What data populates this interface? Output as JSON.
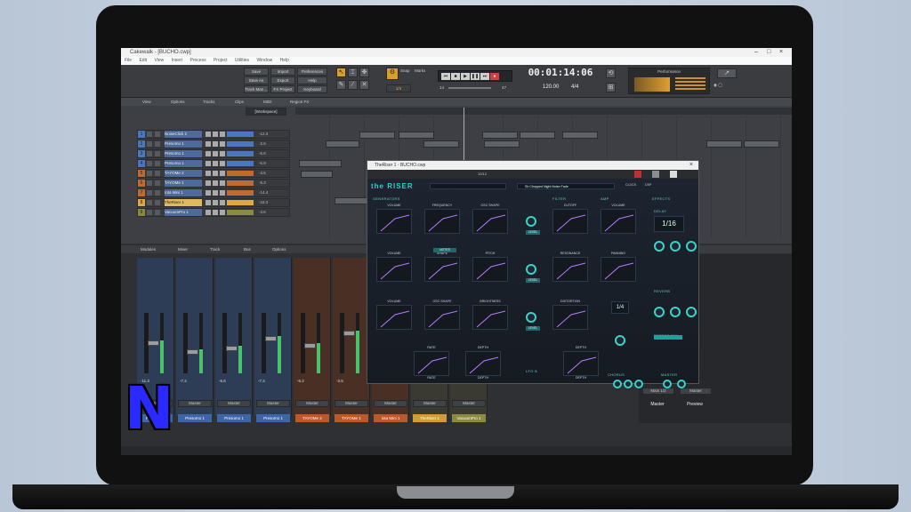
{
  "window": {
    "title": "Cakewalk - [BUCHO.cwp]",
    "controls": [
      "–",
      "□",
      "×"
    ]
  },
  "menu": [
    "File",
    "Edit",
    "View",
    "Insert",
    "Process",
    "Project",
    "Utilities",
    "Window",
    "Help"
  ],
  "controlbar": {
    "buttons": [
      "Save",
      "Import",
      "Preferences",
      "Save As",
      "Export",
      "Help",
      "Track Man…",
      "FX Project",
      "Keyboard"
    ],
    "snap": "Snap",
    "marks": "Marks",
    "snap_value": "1/4",
    "time": "00:01:14:06",
    "tempo": "120.00",
    "meter": "4/4",
    "performance_label": "Performance",
    "transport_left": "14",
    "transport_right": "47"
  },
  "lane_header": [
    "View",
    "Options",
    "Tracks",
    "Clips",
    "MIDI",
    "Region FX"
  ],
  "workspace": "[Workspace]",
  "tracks": [
    {
      "num": "1",
      "name": "NoiseClick 2",
      "vol": "-12.3",
      "color": "#4a78c0"
    },
    {
      "num": "2",
      "name": "Presomo 1",
      "vol": "-2.6",
      "color": "#4a78c0"
    },
    {
      "num": "3",
      "name": "Presomo 1",
      "vol": "-6.6",
      "color": "#4a78c0"
    },
    {
      "num": "4",
      "name": "Presomo 1",
      "vol": "-6.9",
      "color": "#4a78c0"
    },
    {
      "num": "5",
      "name": "TAYOMe 2",
      "vol": "-3.5",
      "color": "#c06a30"
    },
    {
      "num": "6",
      "name": "TAYOMe 1",
      "vol": "-5.3",
      "color": "#c06a30"
    },
    {
      "num": "7",
      "name": "Iota Mini 1",
      "vol": "-14.4",
      "color": "#c06a30"
    },
    {
      "num": "8",
      "name": "TheRiser 1",
      "vol": "-18.3",
      "color": "#e0a840"
    },
    {
      "num": "9",
      "name": "VacuumPro 1",
      "vol": "-3.6",
      "color": "#8a8a40"
    }
  ],
  "mixer_header": [
    "Modules",
    "Mixer",
    "Track",
    "Bus",
    "Options"
  ],
  "strips": [
    {
      "name": "Presomo 1",
      "color": "#3c66a8",
      "out": "Master",
      "gain": "-11.3",
      "level": 0.55
    },
    {
      "name": "Presomo 1",
      "color": "#3c66a8",
      "out": "Master",
      "gain": "-7.2",
      "level": 0.4
    },
    {
      "name": "Presomo 1",
      "color": "#3c66a8",
      "out": "Master",
      "gain": "-6.6",
      "level": 0.45
    },
    {
      "name": "Presomo 1",
      "color": "#3c66a8",
      "out": "Master",
      "gain": "-7.2",
      "level": 0.62
    },
    {
      "name": "TAYOMe 2",
      "color": "#b85a2a",
      "out": "Master",
      "gain": "-6.2",
      "level": 0.5
    },
    {
      "name": "TAYOMe 1",
      "color": "#b85a2a",
      "out": "Master",
      "gain": "-3.5",
      "level": 0.7
    },
    {
      "name": "Iota Mini 1",
      "color": "#b85a2a",
      "out": "Master",
      "gain": "-24.0",
      "level": 0.35
    },
    {
      "name": "TheRiser 1",
      "color": "#d49a3a",
      "out": "Master",
      "gain": "",
      "level": 0.2
    },
    {
      "name": "VacuumPro 1",
      "color": "#8a8a40",
      "out": "Master",
      "gain": "",
      "level": 0.2
    }
  ],
  "master": {
    "out1": "Main 1/2",
    "out2": "Master",
    "name1": "Master",
    "name2": "Preview"
  },
  "plugin": {
    "title": "TheRiser 1 - BUCHO.cwp",
    "toolbar_label": "12/12",
    "logo": "the RISER",
    "preset": "Sh Chopped Night Noise Fade",
    "tabs": [
      "CLOCK",
      "DSP"
    ],
    "sections": {
      "generators": "GENERATORS",
      "filter": "FILTER",
      "amp": "AMP",
      "effects": "EFFECTS",
      "lfo_a": "LFO A",
      "lfo_b": "LFO B",
      "chorus": "CHORUS",
      "reverb": "REVERB",
      "delay": "DELAY",
      "effect_mix": "EFFECT MIX",
      "master": "MASTER"
    },
    "gen_row1": [
      "VOLUME",
      "FREQUENCY",
      "OSC SHAPE"
    ],
    "gen_row2": [
      "VOLUME",
      "SHAPE",
      "PITCH"
    ],
    "gen_row3": [
      "VOLUME",
      "OSC SHAPE",
      "BRIGHTNESS"
    ],
    "filter_row": [
      "CUTOFF",
      "RESONANCE",
      "DISTORTION"
    ],
    "amp_row": [
      "VOLUME",
      "PANNING"
    ],
    "lfo_labels": [
      "RATE",
      "DEPTH",
      "DEPTH"
    ],
    "delay_value": "1/16",
    "lfo_value": "1/4",
    "master_labels": [
      "LEVEL",
      "FILTER",
      "PITCH",
      "WIDTH",
      "VOL"
    ],
    "misc": [
      "NOTES",
      "LEVEL",
      "LEVEL",
      "LEVEL",
      "SINE",
      "SINE",
      "TIME",
      "FEEDB",
      "MIX",
      "FREQ"
    ]
  }
}
